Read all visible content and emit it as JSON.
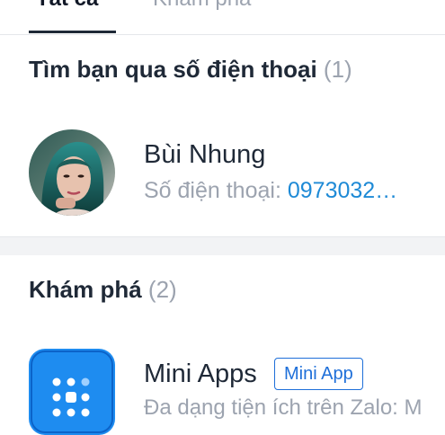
{
  "tabs": [
    {
      "label": "Tất cả",
      "active": true
    },
    {
      "label": "Khám phá",
      "active": false
    }
  ],
  "phone_section": {
    "title": "Tìm bạn qua số điện thoại",
    "count": "(1)",
    "contact": {
      "name": "Bùi Nhung",
      "phone_label": "Số điện thoại:",
      "phone_number": "0973032…"
    }
  },
  "discover_section": {
    "title": "Khám phá",
    "count": "(2)",
    "app": {
      "name": "Mini Apps",
      "badge": "Mini App",
      "description": "Đa dạng tiện ích trên Zalo: M"
    }
  },
  "colors": {
    "accent": "#1e8ad6",
    "badge": "#1e6fd9",
    "app_icon_bg": "#1e8cf0",
    "muted": "#9ca3af"
  },
  "icons": {
    "contact_avatar": "profile-photo",
    "app_icon": "mini-apps-grid-icon"
  }
}
